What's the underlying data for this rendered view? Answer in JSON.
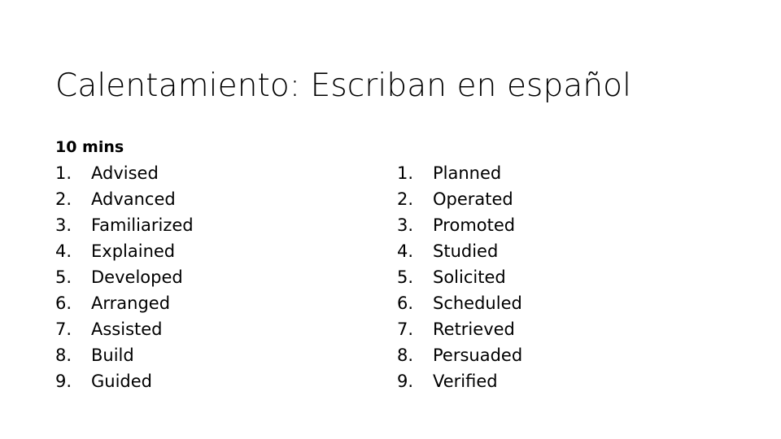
{
  "slide": {
    "title": "Calentamiento: Escriban en español",
    "background_color": "#FFFFFF",
    "text_color": "#000000"
  },
  "left_column": {
    "time_label": "10 mins",
    "items": [
      {
        "number": "1.",
        "label": "Advised"
      },
      {
        "number": "2.",
        "label": "Advanced"
      },
      {
        "number": "3.",
        "label": "Familiarized"
      },
      {
        "number": "4.",
        "label": "Explained"
      },
      {
        "number": "5.",
        "label": "Developed"
      },
      {
        "number": "6.",
        "label": "Arranged"
      },
      {
        "number": "7.",
        "label": "Assisted"
      },
      {
        "number": "8.",
        "label": "Build"
      },
      {
        "number": "9.",
        "label": "Guided"
      }
    ]
  },
  "right_column": {
    "items": [
      {
        "number": "1.",
        "label": "Planned"
      },
      {
        "number": "2.",
        "label": "Operated"
      },
      {
        "number": "3.",
        "label": "Promoted"
      },
      {
        "number": "4.",
        "label": "Studied"
      },
      {
        "number": "5.",
        "label": "Solicited"
      },
      {
        "number": "6.",
        "label": "Scheduled"
      },
      {
        "number": "7.",
        "label": "Retrieved"
      },
      {
        "number": "8.",
        "label": "Persuaded"
      },
      {
        "number": "9.",
        "label": "Verified"
      }
    ]
  }
}
